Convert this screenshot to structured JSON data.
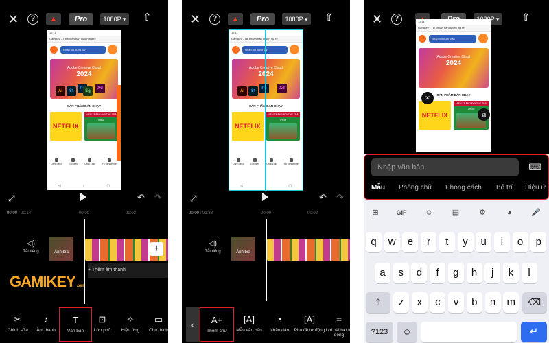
{
  "topbar": {
    "close": "✕",
    "help": "?",
    "pro": "Pro",
    "resolution": "1080P ▾",
    "export": "⇧"
  },
  "preview": {
    "status_time": "12:11",
    "url": "Gamikey - Tài khoản bản quyền giá rẻ",
    "search_placeholder": "Nhập nội dung cần",
    "banner_line1": "Adobe Creative Cloud",
    "banner_year": "2024",
    "tiles": [
      "Ai",
      "St",
      "Ps",
      "Xd",
      "Sg",
      "Sg"
    ],
    "section_title": "SẢN PHẨM BÁN CHẠY",
    "card_netflix": "NETFLIX",
    "card_k_header": "MIỄN TRẮNG ĐỔI THẺ TRẢ THÊM",
    "nav_items": [
      "Danh Mục",
      "Gọi điện",
      "Chat Zalo",
      "Fb Messenger"
    ]
  },
  "panel1": {
    "time_current": "00:00",
    "time_total": "/ 00:14",
    "tick1": "00:00",
    "tick2": "00:02",
    "mute_label": "Tắt tiếng",
    "cover_label": "Ảnh bìa",
    "add_audio": "+ Thêm âm thanh",
    "watermark": "GAMIKEY",
    "watermark_domain": ".com",
    "tools": [
      "Chỉnh sửa",
      "Âm thanh",
      "Văn bản",
      "Lớp phủ",
      "Hiệu ứng",
      "Chú thích"
    ]
  },
  "panel2": {
    "time_current": "00:00",
    "time_total": "/ 01:38",
    "tick1": "00:00",
    "tick2": "00:02",
    "mute_label": "Tắt tiếng",
    "cover_label": "Ảnh bìa",
    "tools": [
      "Thêm chữ",
      "Mẫu văn bản",
      "Nhãn dán",
      "Phụ đề tự động",
      "Lời bài hát tự động"
    ]
  },
  "panel3": {
    "text_placeholder": "Nhập văn bản",
    "tabs": [
      "Mẫu",
      "Phông chữ",
      "Phong cách",
      "Bố trí",
      "Hiệu ứ"
    ],
    "kb_toolbar": [
      "⊞",
      "GIF",
      "☺",
      "▤",
      "⚙",
      "◕",
      "🎤"
    ],
    "row1": [
      "q",
      "w",
      "e",
      "r",
      "t",
      "y",
      "u",
      "i",
      "o",
      "p"
    ],
    "row2": [
      "a",
      "s",
      "d",
      "f",
      "g",
      "h",
      "j",
      "k",
      "l"
    ],
    "row3": [
      "z",
      "x",
      "c",
      "v",
      "b",
      "n",
      "m"
    ],
    "shift": "⇧",
    "backspace": "⌫",
    "sym": "?123",
    "emoji": "☺",
    "enter": "↵"
  },
  "colors": {
    "accent_red": "#e02020",
    "brand_orange": "#ff6a13",
    "enter_blue": "#2f6df0"
  }
}
